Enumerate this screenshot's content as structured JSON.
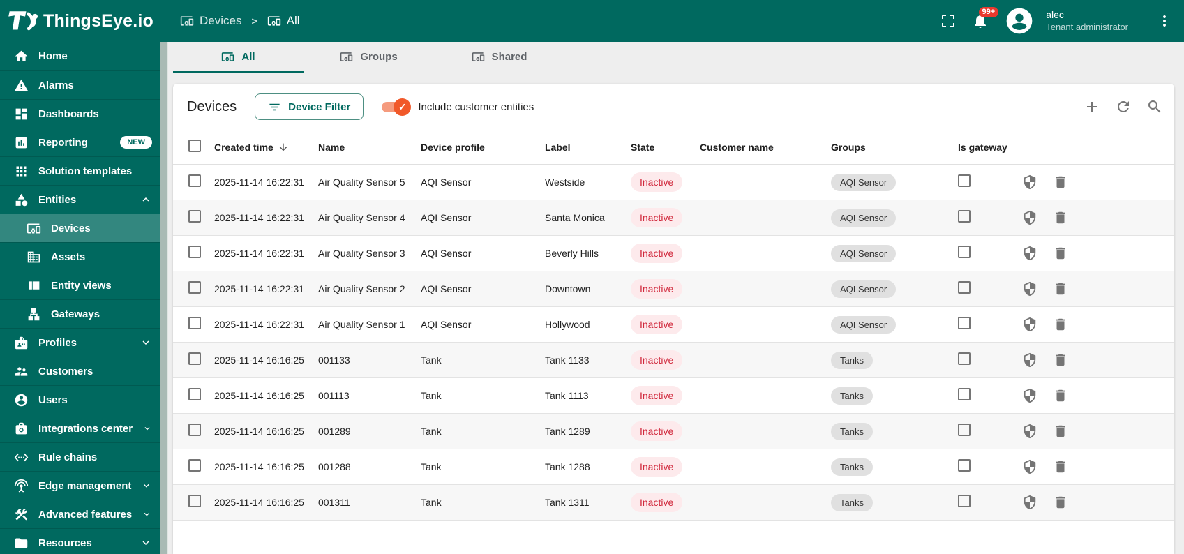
{
  "header": {
    "logo_text": "ThingsEye.io",
    "breadcrumb": {
      "items": [
        {
          "label": "Devices",
          "icon": "devices-icon"
        },
        {
          "label": "All",
          "icon": "devices-icon"
        }
      ],
      "separator": ">"
    },
    "notification_badge": "99+",
    "user_name": "alec",
    "user_role": "Tenant administrator"
  },
  "sidebar": {
    "items": [
      {
        "label": "Home",
        "icon": "home-icon"
      },
      {
        "label": "Alarms",
        "icon": "alarms-icon"
      },
      {
        "label": "Dashboards",
        "icon": "dashboards-icon"
      },
      {
        "label": "Reporting",
        "icon": "reporting-icon",
        "badge": "NEW"
      },
      {
        "label": "Solution templates",
        "icon": "solution-templates-icon"
      },
      {
        "label": "Entities",
        "icon": "entities-icon",
        "chevron": "up"
      },
      {
        "label": "Devices",
        "icon": "devices-icon",
        "child": true,
        "selected": true
      },
      {
        "label": "Assets",
        "icon": "assets-icon",
        "child": true
      },
      {
        "label": "Entity views",
        "icon": "entity-views-icon",
        "child": true
      },
      {
        "label": "Gateways",
        "icon": "gateways-icon",
        "child": true
      },
      {
        "label": "Profiles",
        "icon": "profiles-icon",
        "chevron": "down"
      },
      {
        "label": "Customers",
        "icon": "customers-icon"
      },
      {
        "label": "Users",
        "icon": "users-icon"
      },
      {
        "label": "Integrations center",
        "icon": "integrations-icon",
        "chevron": "down"
      },
      {
        "label": "Rule chains",
        "icon": "rule-chains-icon"
      },
      {
        "label": "Edge management",
        "icon": "edge-management-icon",
        "chevron": "down"
      },
      {
        "label": "Advanced features",
        "icon": "advanced-features-icon",
        "chevron": "down"
      },
      {
        "label": "Resources",
        "icon": "resources-icon",
        "chevron": "down"
      }
    ]
  },
  "tabs": [
    {
      "label": "All",
      "icon": "devices-icon",
      "active": true
    },
    {
      "label": "Groups",
      "icon": "devices-icon",
      "active": false
    },
    {
      "label": "Shared",
      "icon": "devices-icon",
      "active": false
    }
  ],
  "panel": {
    "title": "Devices",
    "filter_button_label": "Device Filter",
    "toggle_label": "Include customer entities",
    "toggle_on": true,
    "toolbar_icons": [
      "add-icon",
      "refresh-icon",
      "search-icon"
    ]
  },
  "table": {
    "columns": [
      "Created time",
      "Name",
      "Device profile",
      "Label",
      "State",
      "Customer name",
      "Groups",
      "Is gateway"
    ],
    "sorted_by": "Created time",
    "sort_direction": "desc",
    "rows": [
      {
        "created_time": "2025-11-14 16:22:31",
        "name": "Air Quality Sensor 5",
        "device_profile": "AQI Sensor",
        "label": "Westside",
        "state": "Inactive",
        "customer_name": "",
        "group": "AQI Sensor",
        "is_gateway": false
      },
      {
        "created_time": "2025-11-14 16:22:31",
        "name": "Air Quality Sensor 4",
        "device_profile": "AQI Sensor",
        "label": "Santa Monica",
        "state": "Inactive",
        "customer_name": "",
        "group": "AQI Sensor",
        "is_gateway": false
      },
      {
        "created_time": "2025-11-14 16:22:31",
        "name": "Air Quality Sensor 3",
        "device_profile": "AQI Sensor",
        "label": "Beverly Hills",
        "state": "Inactive",
        "customer_name": "",
        "group": "AQI Sensor",
        "is_gateway": false
      },
      {
        "created_time": "2025-11-14 16:22:31",
        "name": "Air Quality Sensor 2",
        "device_profile": "AQI Sensor",
        "label": "Downtown",
        "state": "Inactive",
        "customer_name": "",
        "group": "AQI Sensor",
        "is_gateway": false
      },
      {
        "created_time": "2025-11-14 16:22:31",
        "name": "Air Quality Sensor 1",
        "device_profile": "AQI Sensor",
        "label": "Hollywood",
        "state": "Inactive",
        "customer_name": "",
        "group": "AQI Sensor",
        "is_gateway": false
      },
      {
        "created_time": "2025-11-14 16:16:25",
        "name": "001133",
        "device_profile": "Tank",
        "label": "Tank 1133",
        "state": "Inactive",
        "customer_name": "",
        "group": "Tanks",
        "is_gateway": false
      },
      {
        "created_time": "2025-11-14 16:16:25",
        "name": "001113",
        "device_profile": "Tank",
        "label": "Tank 1113",
        "state": "Inactive",
        "customer_name": "",
        "group": "Tanks",
        "is_gateway": false
      },
      {
        "created_time": "2025-11-14 16:16:25",
        "name": "001289",
        "device_profile": "Tank",
        "label": "Tank 1289",
        "state": "Inactive",
        "customer_name": "",
        "group": "Tanks",
        "is_gateway": false
      },
      {
        "created_time": "2025-11-14 16:16:25",
        "name": "001288",
        "device_profile": "Tank",
        "label": "Tank 1288",
        "state": "Inactive",
        "customer_name": "",
        "group": "Tanks",
        "is_gateway": false
      },
      {
        "created_time": "2025-11-14 16:16:25",
        "name": "001311",
        "device_profile": "Tank",
        "label": "Tank 1311",
        "state": "Inactive",
        "customer_name": "",
        "group": "Tanks",
        "is_gateway": false
      }
    ]
  },
  "colors": {
    "brand_teal": "#00695f",
    "toggle_orange": "#f1592a",
    "toggle_track": "#f59b7e",
    "state_inactive_text": "#d1293d",
    "state_inactive_bg": "#fdeaec",
    "chip_bg": "#e0e0e0",
    "badge_red": "#e8392e"
  }
}
